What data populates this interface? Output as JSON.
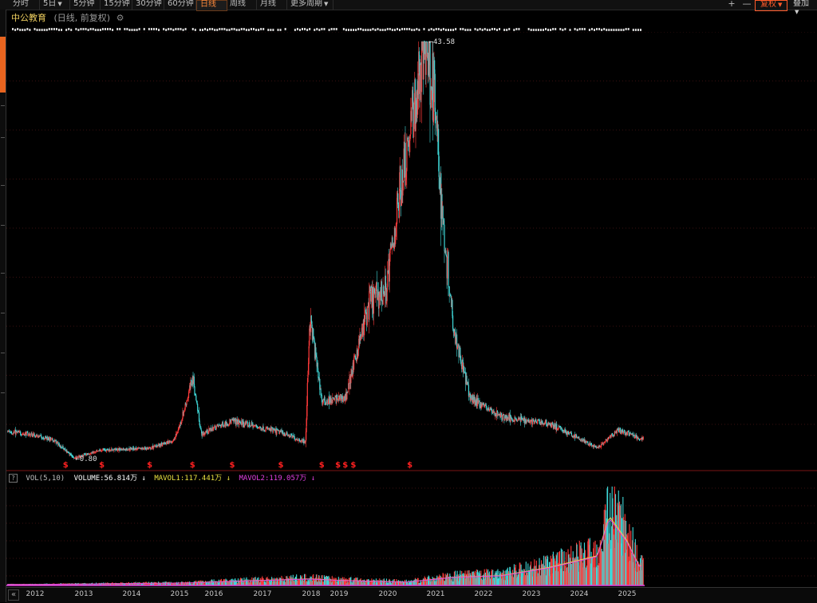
{
  "toolbar": {
    "periods": [
      {
        "label": "分时",
        "active": false
      },
      {
        "label": "5日",
        "active": false,
        "dropdown": true
      },
      {
        "label": "5分钟",
        "active": false
      },
      {
        "label": "15分钟",
        "active": false
      },
      {
        "label": "30分钟",
        "active": false
      },
      {
        "label": "60分钟",
        "active": false
      },
      {
        "label": "日线",
        "active": true
      },
      {
        "label": "周线",
        "active": false
      },
      {
        "label": "月线",
        "active": false
      },
      {
        "label": "更多周期",
        "active": false,
        "dropdown": true
      }
    ],
    "zoom_in": "+",
    "zoom_out": "—",
    "fuquan_label": "复权",
    "overlay_label": "叠加"
  },
  "title": {
    "name": "中公教育",
    "subtitle": "(日线, 前复权)"
  },
  "icons": {
    "settings": "gear-icon",
    "help": "question-icon",
    "nav": "double-chevron-left-icon"
  },
  "colors": {
    "up": "#ff3b3b",
    "down": "#3fd8d8",
    "ma1": "#e8e040",
    "ma2": "#e040e0",
    "grid": "#3a1010",
    "accent": "#e8641f",
    "dividend": "#ff2020"
  },
  "volume_legend": {
    "help": "?",
    "name": "VOL(5,10)",
    "volume": "VOLUME:56.814万 ↓",
    "mavol1": "MAVOL1:117.441万 ↓",
    "mavol2": "MAVOL2:119.057万 ↓"
  },
  "chart_data": {
    "type": "candlestick",
    "x_axis_years": [
      "2012",
      "2013",
      "2014",
      "2015",
      "2016",
      "2017",
      "2018",
      "2019",
      "2020",
      "2021",
      "2022",
      "2023",
      "2024",
      "2025"
    ],
    "price_series_key_points": [
      {
        "date": "2011-12",
        "price": 3.3
      },
      {
        "date": "2012-06",
        "price": 2.6
      },
      {
        "date": "2012-11",
        "price": 0.8
      },
      {
        "date": "2013-06",
        "price": 1.6
      },
      {
        "date": "2014-06",
        "price": 1.8
      },
      {
        "date": "2014-12",
        "price": 2.6
      },
      {
        "date": "2015-06",
        "price": 9.0
      },
      {
        "date": "2015-09",
        "price": 3.2
      },
      {
        "date": "2016-06",
        "price": 4.6
      },
      {
        "date": "2017-06",
        "price": 3.4
      },
      {
        "date": "2017-12",
        "price": 2.4
      },
      {
        "date": "2018-01",
        "price": 15.0
      },
      {
        "date": "2018-06",
        "price": 6.5
      },
      {
        "date": "2019-03",
        "price": 7.0
      },
      {
        "date": "2019-09",
        "price": 17.0
      },
      {
        "date": "2020-01",
        "price": 18.0
      },
      {
        "date": "2020-05",
        "price": 30.0
      },
      {
        "date": "2020-11",
        "price": 43.58
      },
      {
        "date": "2021-01",
        "price": 38.0
      },
      {
        "date": "2021-03",
        "price": 26.0
      },
      {
        "date": "2021-06",
        "price": 14.0
      },
      {
        "date": "2021-10",
        "price": 7.0
      },
      {
        "date": "2022-06",
        "price": 5.0
      },
      {
        "date": "2023-06",
        "price": 4.3
      },
      {
        "date": "2024-06",
        "price": 1.8
      },
      {
        "date": "2024-11",
        "price": 3.6
      },
      {
        "date": "2025-06",
        "price": 2.8
      }
    ],
    "annotations": {
      "high": "43.58",
      "low": "0.80"
    },
    "dividend_marker": "$",
    "dividend_dates": [
      "2012-09",
      "2013-06",
      "2014-06",
      "2015-06",
      "2016-06",
      "2017-06",
      "2018-06",
      "2019-01",
      "2019-03",
      "2019-05",
      "2020-07"
    ],
    "volume_series_key_points": [
      {
        "date": "2012-01",
        "volume": 3
      },
      {
        "date": "2015-06",
        "volume": 8
      },
      {
        "date": "2018-01",
        "volume": 20
      },
      {
        "date": "2020-06",
        "volume": 10
      },
      {
        "date": "2021-06",
        "volume": 25
      },
      {
        "date": "2022-06",
        "volume": 30
      },
      {
        "date": "2023-06",
        "volume": 55
      },
      {
        "date": "2024-06",
        "volume": 90
      },
      {
        "date": "2024-09",
        "volume": 210
      },
      {
        "date": "2025-06",
        "volume": 60
      }
    ],
    "series": [
      {
        "name": "VOLUME",
        "latest": "56.814万"
      },
      {
        "name": "MAVOL1",
        "latest": "117.441万"
      },
      {
        "name": "MAVOL2",
        "latest": "119.057万"
      }
    ]
  }
}
